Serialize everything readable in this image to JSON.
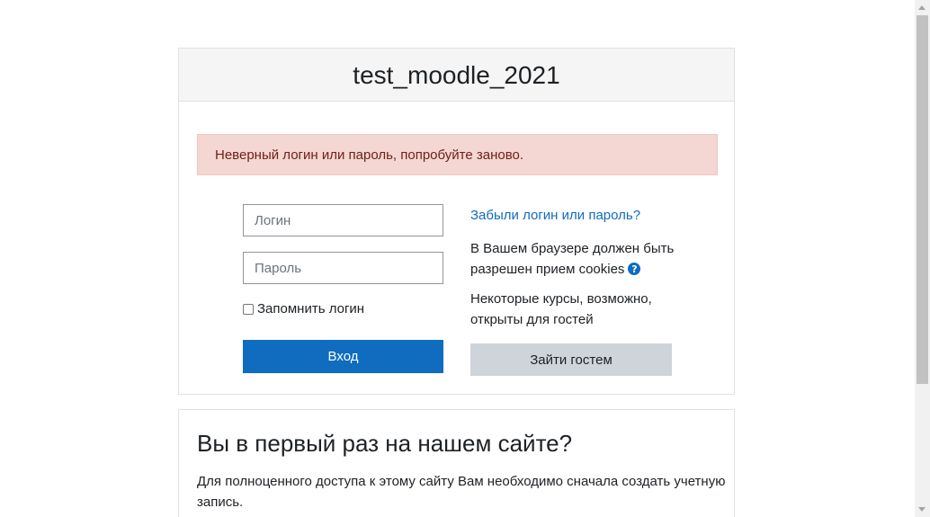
{
  "site": {
    "title": "test_moodle_2021"
  },
  "alert": {
    "message": "Неверный логин или пароль, попробуйте заново."
  },
  "login_form": {
    "username_placeholder": "Логин",
    "password_placeholder": "Пароль",
    "remember_label": "Запомнить логин",
    "remember_checked": false,
    "login_button": "Вход"
  },
  "side_info": {
    "forgot_link": "Забыли логин или пароль?",
    "cookies_text": "В Вашем браузере должен быть разрешен прием cookies",
    "help_icon_glyph": "?",
    "guest_text": "Некоторые курсы, возможно, открыты для гостей",
    "guest_button": "Зайти гостем"
  },
  "signup": {
    "title": "Вы в первый раз на нашем сайте?",
    "text": "Для полноценного доступа к этому сайту Вам необходимо сначала создать учетную запись."
  },
  "colors": {
    "primary": "#0f6cbf",
    "alert_bg": "#f4d6d2",
    "alert_text": "#6e211a",
    "secondary_button": "#ced4da",
    "header_bg": "#f5f5f5"
  }
}
